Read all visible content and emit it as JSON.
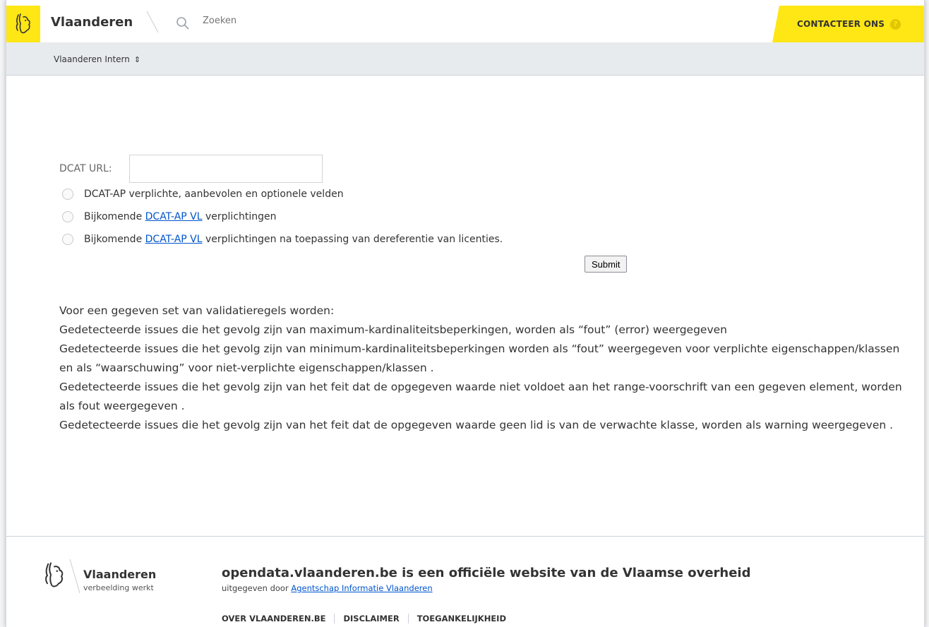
{
  "header": {
    "brand": "Vlaanderen",
    "search_placeholder": "Zoeken",
    "contact_label": "CONTACTEER ONS",
    "help_glyph": "?",
    "accent_color": "#ffe615"
  },
  "subnav": {
    "label": "Vlaanderen Intern",
    "chevron": "⌃⌄"
  },
  "form": {
    "url_label": "DCAT URL:",
    "url_value": "",
    "options": [
      {
        "prefix": "DCAT-AP verplichte, aanbevolen en optionele velden",
        "link": "",
        "suffix": ""
      },
      {
        "prefix": "Bijkomende ",
        "link": "DCAT-AP VL",
        "suffix": " verplichtingen"
      },
      {
        "prefix": "Bijkomende ",
        "link": "DCAT-AP VL",
        "suffix": " verplichtingen na toepassing van dereferentie van licenties."
      }
    ],
    "submit_label": "Submit"
  },
  "info": {
    "intro": "Voor een gegeven set van validatieregels worden:",
    "line1": "Gedetecteerde issues die het gevolg zijn van maximum-kardinaliteitsbeperkingen, worden als “fout” (error) weergegeven",
    "line2": "Gedetecteerde issues die het gevolg zijn van minimum-kardinaliteitsbeperkingen worden als “fout” weergegeven voor verplichte eigenschappen/klassen en als “waarschuwing” voor niet-verplichte eigenschappen/klassen .",
    "line3": "Gedetecteerde issues die het gevolg zijn van het feit dat de opgegeven waarde niet voldoet aan het range-voorschrift van een gegeven element, worden als fout weergegeven .",
    "line4": "Gedetecteerde issues die het gevolg zijn van het feit dat de opgegeven waarde geen lid is van de verwachte klasse, worden als warning weergegeven ."
  },
  "footer": {
    "brand": "Vlaanderen",
    "tagline": "verbeelding werkt",
    "title": "opendata.vlaanderen.be is een officiële website van de Vlaamse overheid",
    "published_by": "uitgegeven door ",
    "agency_link": "Agentschap Informatie Vlaanderen",
    "links": [
      "OVER VLAANDEREN.BE",
      "DISCLAIMER",
      "TOEGANKELIJKHEID"
    ]
  }
}
